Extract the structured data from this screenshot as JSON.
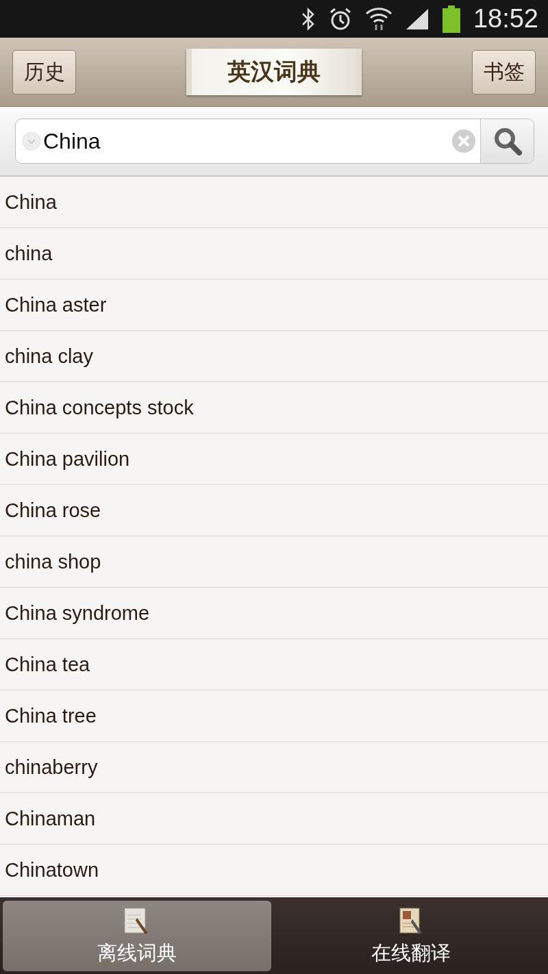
{
  "status_bar": {
    "time": "18:52"
  },
  "header": {
    "left_button": "历史",
    "title": "英汉词典",
    "right_button": "书签"
  },
  "search": {
    "value": "China"
  },
  "results": [
    "China",
    "china",
    "China aster",
    "china clay",
    "China concepts stock",
    "China pavilion",
    "China rose",
    "china shop",
    "China syndrome",
    "China tea",
    "China tree",
    "chinaberry",
    "Chinaman",
    "Chinatown"
  ],
  "tabs": [
    {
      "label": "离线词典",
      "selected": true,
      "kind": "offline"
    },
    {
      "label": "在线翻译",
      "selected": false,
      "kind": "online"
    }
  ]
}
